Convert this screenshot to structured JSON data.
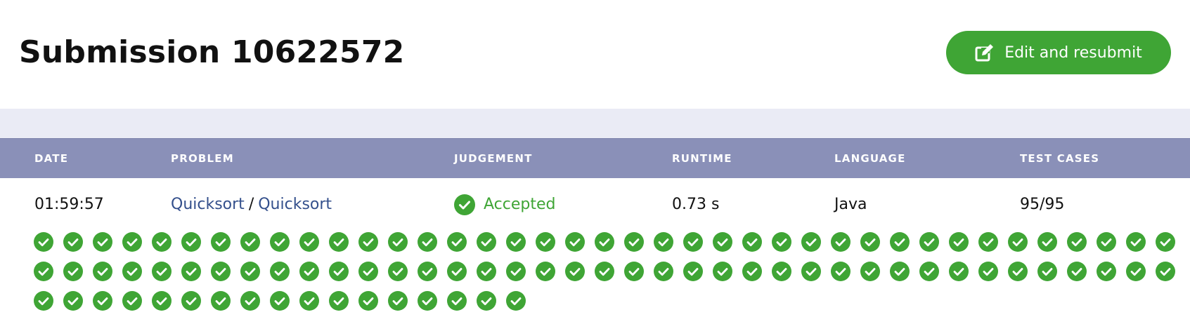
{
  "submission": {
    "title": "Submission 10622572",
    "resubmit_label": "Edit and resubmit"
  },
  "table": {
    "headers": [
      "DATE",
      "PROBLEM",
      "JUDGEMENT",
      "RUNTIME",
      "LANGUAGE",
      "TEST CASES"
    ],
    "row": {
      "date": "01:59:57",
      "problem_links": [
        "Quicksort",
        "Quicksort"
      ],
      "problem_separator": "/",
      "judgement": "Accepted",
      "runtime": "0.73 s",
      "language": "Java",
      "test_cases": "95/95"
    }
  },
  "test_case_results": {
    "passed": 95,
    "total": 95,
    "status": "accepted",
    "icon": "check-circle-icon"
  },
  "colors": {
    "accent_green": "#3fa535",
    "table_header": "#8a90b8",
    "link": "#34508c",
    "band": "#eaebf5"
  }
}
